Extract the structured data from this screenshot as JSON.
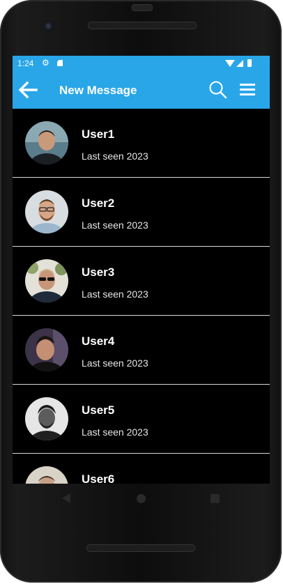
{
  "status_bar": {
    "time": "1:24",
    "icons": [
      "gear-icon",
      "sd-card-icon",
      "wifi-icon",
      "signal-icon",
      "battery-icon"
    ]
  },
  "app_bar": {
    "title": "New Message",
    "icons": [
      "back-arrow-icon",
      "search-icon",
      "menu-icon"
    ],
    "color": "#29a6e8"
  },
  "contacts": [
    {
      "name": "User1",
      "status": "Last seen 2023"
    },
    {
      "name": "User2",
      "status": "Last seen 2023"
    },
    {
      "name": "User3",
      "status": "Last seen 2023"
    },
    {
      "name": "User4",
      "status": "Last seen 2023"
    },
    {
      "name": "User5",
      "status": "Last seen 2023"
    },
    {
      "name": "User6",
      "status": ""
    }
  ],
  "nav_bar": {
    "icons": [
      "nav-back-icon",
      "nav-home-icon",
      "nav-recents-icon"
    ]
  },
  "colors": {
    "accent": "#29a6e8",
    "screen_background": "#000000",
    "divider": "#d9d9d9"
  }
}
